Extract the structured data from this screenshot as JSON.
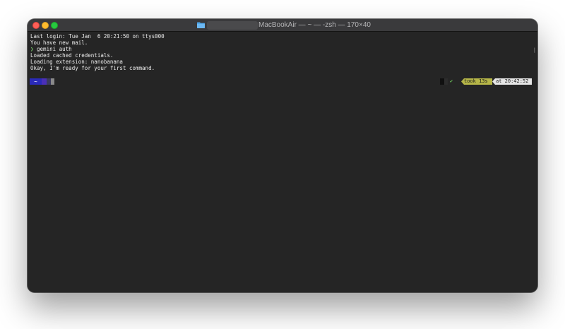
{
  "window": {
    "title": "MacBookAir — ~ — -zsh — 170×40",
    "title_icon": "folder-icon",
    "traffic_lights": {
      "close": "#fe5f57",
      "minimize": "#febc2e",
      "maximize": "#28c840"
    }
  },
  "terminal": {
    "lines": [
      "Last login: Tue Jan  6 20:21:50 on ttys000",
      "You have new mail."
    ],
    "command": {
      "prompt": "❯",
      "text": " gemini auth"
    },
    "output": [
      "Loaded cached credentials.",
      "Loading extension: nanobanana",
      "Okay, I'm ready for your first command."
    ],
    "prompt_left": {
      "dir": "~"
    },
    "prompt_right": {
      "status": "✔",
      "duration": "took 13s",
      "time": "at 20:42:52"
    },
    "colors": {
      "background": "#252525",
      "text": "#ececec",
      "dir_segment": "#2a2ab8",
      "duration_segment": "#b6b648",
      "time_segment": "#e6e6e6"
    }
  }
}
